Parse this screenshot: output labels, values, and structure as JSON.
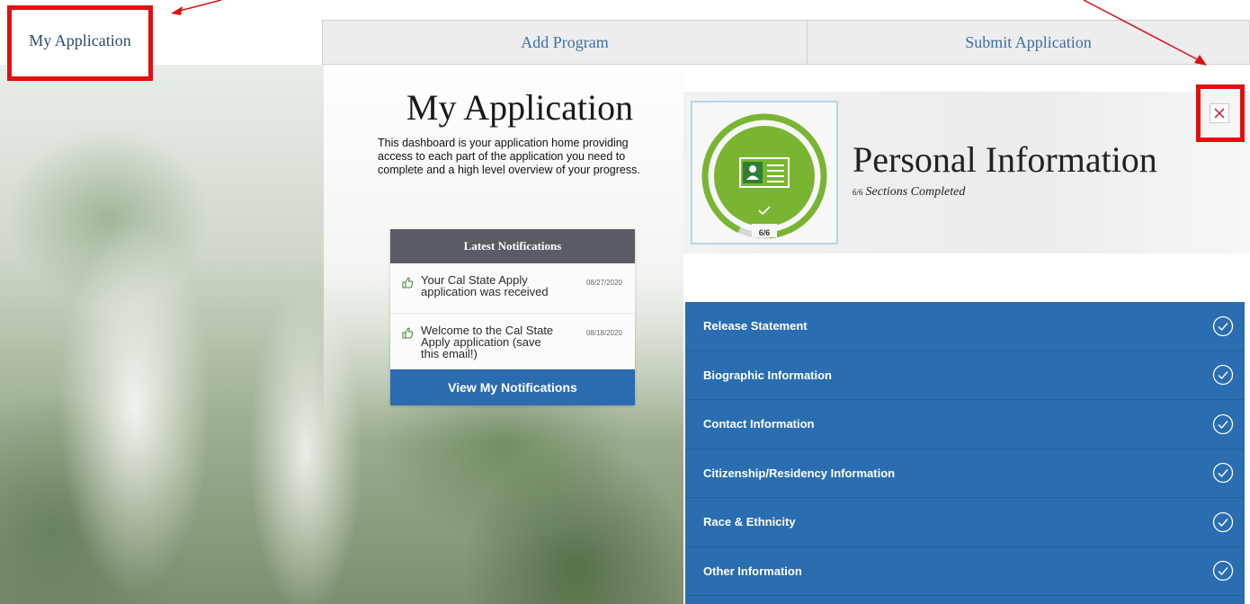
{
  "nav": {
    "my_application": "My Application",
    "add_program": "Add Program",
    "submit_application": "Submit Application"
  },
  "intro": {
    "title": "My Application",
    "description": "This dashboard is your application home providing access to each part of the application you need to complete and a high level overview of your progress."
  },
  "notifications": {
    "header": "Latest Notifications",
    "items": [
      {
        "text": "Your Cal State Apply application was received",
        "date": "08/27/2020",
        "icon": "thumbs-up-icon"
      },
      {
        "text": "Welcome to the Cal State Apply application (save this email!)",
        "date": "08/18/2020",
        "icon": "thumbs-up-icon"
      }
    ],
    "button_label": "View My Notifications"
  },
  "panel": {
    "title": "Personal Information",
    "sections_fraction": "6/6",
    "sections_label": "Sections Completed",
    "badge_label": "6/6",
    "badge_icon": "id-card-icon",
    "progress_fraction": 1.0,
    "close_icon": "close-icon",
    "sections": [
      {
        "label": "Release Statement",
        "complete": true
      },
      {
        "label": "Biographic Information",
        "complete": true
      },
      {
        "label": "Contact Information",
        "complete": true
      },
      {
        "label": "Citizenship/Residency Information",
        "complete": true
      },
      {
        "label": "Race & Ethnicity",
        "complete": true
      },
      {
        "label": "Other Information",
        "complete": true
      }
    ]
  },
  "colors": {
    "accent_blue": "#2a6db1",
    "badge_green": "#7ab532",
    "annotation_red": "#e01010",
    "notif_header": "#595c62"
  }
}
